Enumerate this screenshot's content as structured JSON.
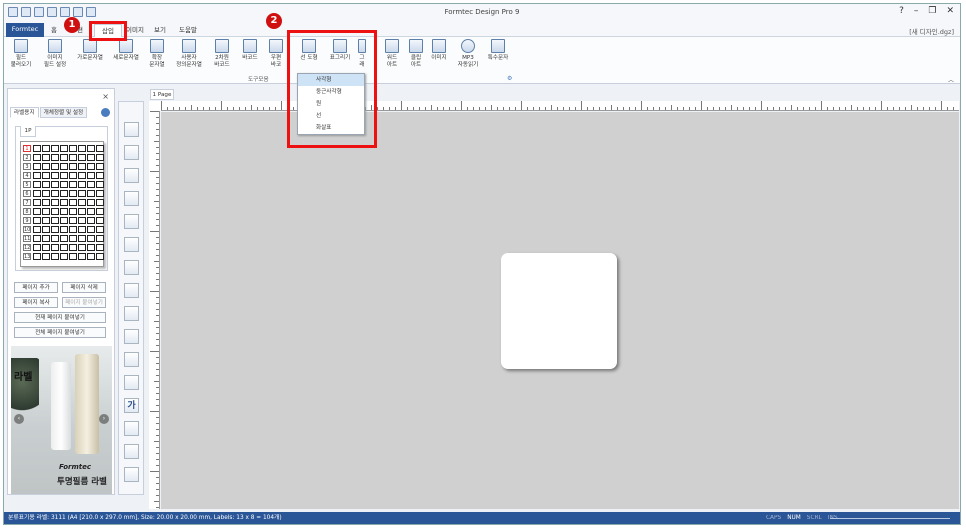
{
  "window": {
    "title": "Formtec Design Pro 9",
    "doc_name": "[새 디자인.dgz]",
    "controls": [
      "?",
      "–",
      "❐",
      "✕"
    ]
  },
  "menu": {
    "file": "Formtec",
    "tabs": [
      "홈",
      "편",
      "삽입",
      "이미지",
      "보기",
      "도움말"
    ]
  },
  "ribbon": {
    "buttons": [
      "필드\n불러오기",
      "이미지\n필드 설정",
      "가로문자열",
      "세로문자열",
      "확장\n문자열",
      "사용자\n정의문자열",
      "2차원\n바코드",
      "바코드",
      "우편\n바코",
      "선 도형",
      "표그리기",
      "그\n래",
      "워드\n아트",
      "클립\n아트",
      "이미지",
      "MP3\n자동읽기",
      "특수문자"
    ],
    "group_label": "도구모음"
  },
  "shape_dropdown": {
    "items": [
      "사각형",
      "둥근사각형",
      "원",
      "선",
      "화살표"
    ],
    "highlighted": "사각형"
  },
  "left_panel": {
    "tabs": [
      "라벨용지",
      "개체정렬 및 설정"
    ],
    "page_tab": "1P",
    "row_numbers": [
      "1",
      "2",
      "3",
      "4",
      "5",
      "6",
      "7",
      "8",
      "9",
      "10",
      "11",
      "12",
      "13"
    ],
    "buttons": {
      "add": "페이지 추가",
      "delete": "페이지 삭제",
      "copy": "페이지 복사",
      "paste": "페이지 붙여넣기",
      "paste_current": "현재 페이지 붙여넣기",
      "paste_all": "전체 페이지 붙여넣기"
    },
    "ad": {
      "text_top": "라벨",
      "brand": "Formtec",
      "text_bottom": "투명필름 라벨"
    }
  },
  "toolbox": {
    "wordart_glyph": "가"
  },
  "canvas": {
    "page_tab": "1 Page",
    "ruler_labels": [
      "0",
      "1",
      "2",
      "3",
      "4",
      "5",
      "6",
      "7"
    ]
  },
  "status": {
    "info": "분류표기용 라벨: 3111 (A4 [210.0 x 297.0 mm], Size: 20.00 x 20.00 mm, Labels: 13 x 8 = 104개)",
    "indicators": [
      "CAPS",
      "NUM",
      "SCRL",
      "INS"
    ]
  },
  "annotations": {
    "badge1": "1",
    "badge2": "2"
  },
  "colors": {
    "accent": "#2a5597",
    "highlight": "#ee1111"
  }
}
